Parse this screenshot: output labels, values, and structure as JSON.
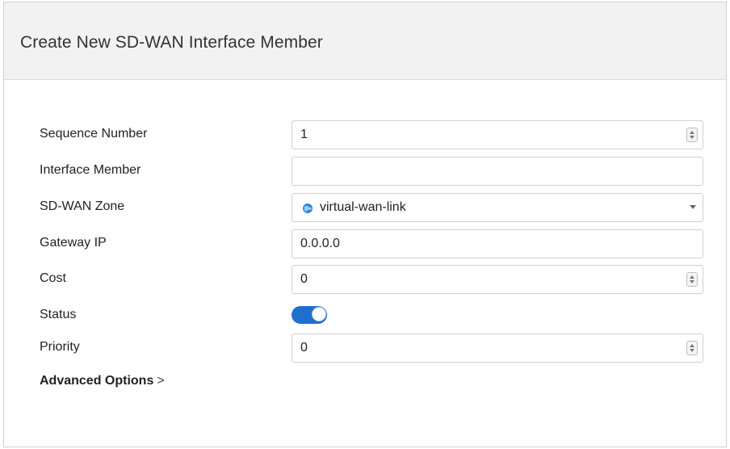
{
  "dialog": {
    "title": "Create New SD-WAN Interface Member"
  },
  "form": {
    "sequence_number": {
      "label": "Sequence Number",
      "value": "1"
    },
    "interface_member": {
      "label": "Interface Member",
      "value": ""
    },
    "sdwan_zone": {
      "label": "SD-WAN Zone",
      "value": "virtual-wan-link"
    },
    "gateway_ip": {
      "label": "Gateway IP",
      "value": "0.0.0.0"
    },
    "cost": {
      "label": "Cost",
      "value": "0"
    },
    "status": {
      "label": "Status",
      "enabled": true
    },
    "priority": {
      "label": "Priority",
      "value": "0"
    }
  },
  "advanced_options": {
    "label": "Advanced Options",
    "chevron": ">"
  },
  "icons": {
    "zone": "globe-icon",
    "spinner": "spinner-icon",
    "dropdown": "chevron-down-icon"
  },
  "colors": {
    "toggle_on": "#1f6fd1",
    "header_bg": "#f2f2f2",
    "zone_icon": "#2f86d8"
  }
}
